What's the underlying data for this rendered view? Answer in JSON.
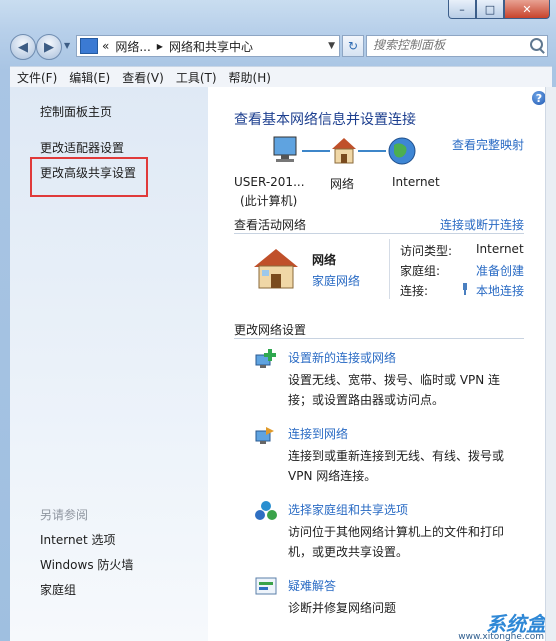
{
  "window": {
    "caption_minimize": "–",
    "caption_maximize": "□",
    "caption_close": "✕"
  },
  "nav": {
    "back_icon": "◀",
    "forward_icon": "▶",
    "dropdown_icon": "▼",
    "address_chevron": "«",
    "address_part1": "网络...",
    "address_sep": "▶",
    "address_part2": "网络和共享中心",
    "address_dropdown": "▼",
    "refresh_icon": "↻",
    "search_placeholder": "搜索控制面板"
  },
  "menu": {
    "file": "文件(F)",
    "edit": "编辑(E)",
    "view": "查看(V)",
    "tools": "工具(T)",
    "help": "帮助(H)"
  },
  "sidebar": {
    "home": "控制面板主页",
    "adapter": "更改适配器设置",
    "advanced": "更改高级共享设置",
    "see_also": "另请参阅",
    "internet_options": "Internet 选项",
    "firewall": "Windows 防火墙",
    "homegroup": "家庭组"
  },
  "main": {
    "help_icon": "?",
    "title": "查看基本网络信息并设置连接",
    "full_map": "查看完整映射",
    "map": {
      "computer_label1": "USER-201...",
      "computer_label2": "(此计算机)",
      "network_label": "网络",
      "internet_label": "Internet"
    },
    "active_header": "查看活动网络",
    "connect_disconnect": "连接或断开连接",
    "network_name": "网络",
    "network_type": "家庭网络",
    "access_type_label": "访问类型:",
    "access_type_value": "Internet",
    "homegroup_label": "家庭组:",
    "homegroup_value": "准备创建",
    "connections_label": "连接:",
    "connections_value": "本地连接",
    "change_header": "更改网络设置",
    "tasks": [
      {
        "title": "设置新的连接或网络",
        "desc": "设置无线、宽带、拨号、临时或 VPN 连接；或设置路由器或访问点。"
      },
      {
        "title": "连接到网络",
        "desc": "连接到或重新连接到无线、有线、拨号或 VPN 网络连接。"
      },
      {
        "title": "选择家庭组和共享选项",
        "desc": "访问位于其他网络计算机上的文件和打印机，或更改共享设置。"
      },
      {
        "title": "疑难解答",
        "desc": "诊断并修复网络问题"
      }
    ]
  },
  "watermark": {
    "brand": "系统盒",
    "url": "www.xitonghe.com"
  },
  "colors": {
    "link": "#2a6bc4",
    "title": "#1d3f8f",
    "highlight_box": "#e03a3a"
  }
}
